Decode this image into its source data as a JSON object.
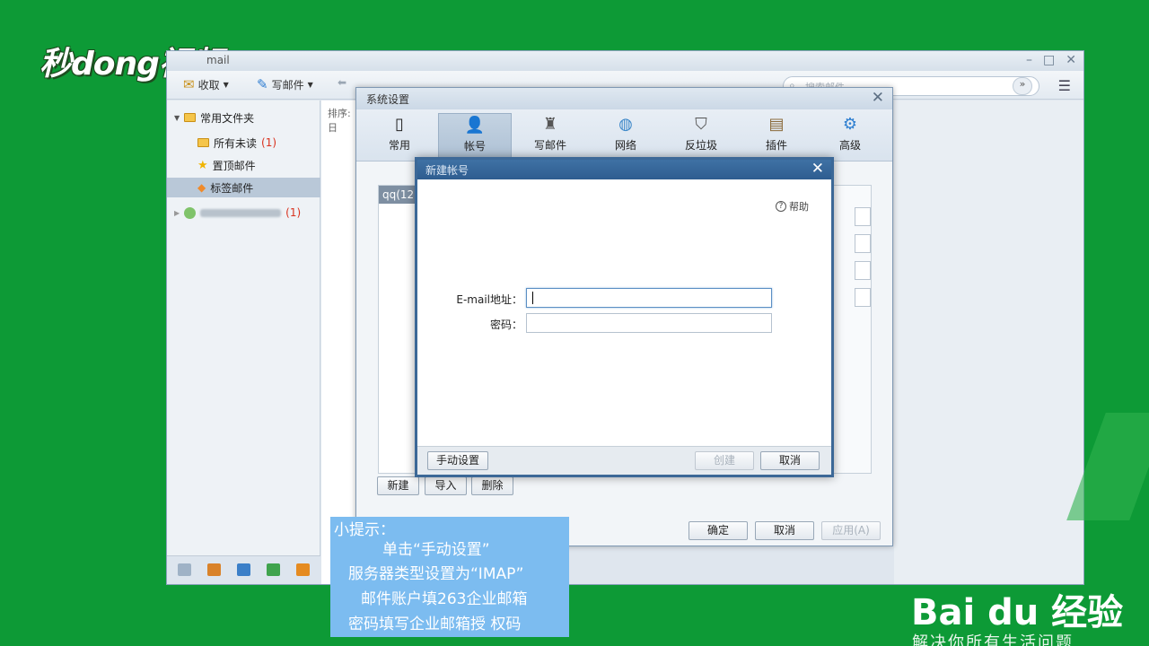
{
  "watermark": {
    "logo": "秒dong视频"
  },
  "main_window": {
    "title": "mail",
    "toolbar": {
      "receive": "收取",
      "compose": "写邮件"
    },
    "search_placeholder": "搜索邮件",
    "sort_label": "排序:日",
    "sidebar": {
      "group": "常用文件夹",
      "items": [
        {
          "label": "所有未读",
          "count": "(1)"
        },
        {
          "label": "置顶邮件"
        },
        {
          "label": "标签邮件"
        }
      ],
      "account_count": "(1)"
    }
  },
  "settings_dialog": {
    "title": "系统设置",
    "tabs": [
      "常用",
      "帐号",
      "写邮件",
      "网络",
      "反垃圾",
      "插件",
      "高级"
    ],
    "account_list_header": "qq(12",
    "buttons": {
      "new": "新建",
      "import": "导入",
      "delete": "删除",
      "ok": "确定",
      "cancel": "取消",
      "apply": "应用(A)"
    }
  },
  "new_account_dialog": {
    "title": "新建帐号",
    "help": "帮助",
    "email_label": "E-mail地址：",
    "email_value": "",
    "password_label": "密码：",
    "password_value": "",
    "buttons": {
      "manual": "手动设置",
      "create": "创建",
      "cancel": "取消"
    }
  },
  "tip": {
    "lines": [
      "小提示：",
      "单击“手动设置”",
      "服务器类型设置为“IMAP”",
      "邮件账户填263企业邮箱",
      "密码填写企业邮箱授  权码"
    ]
  },
  "baidu": {
    "logo": "Bai du 经验",
    "slogan": "解决你所有生活问题"
  }
}
